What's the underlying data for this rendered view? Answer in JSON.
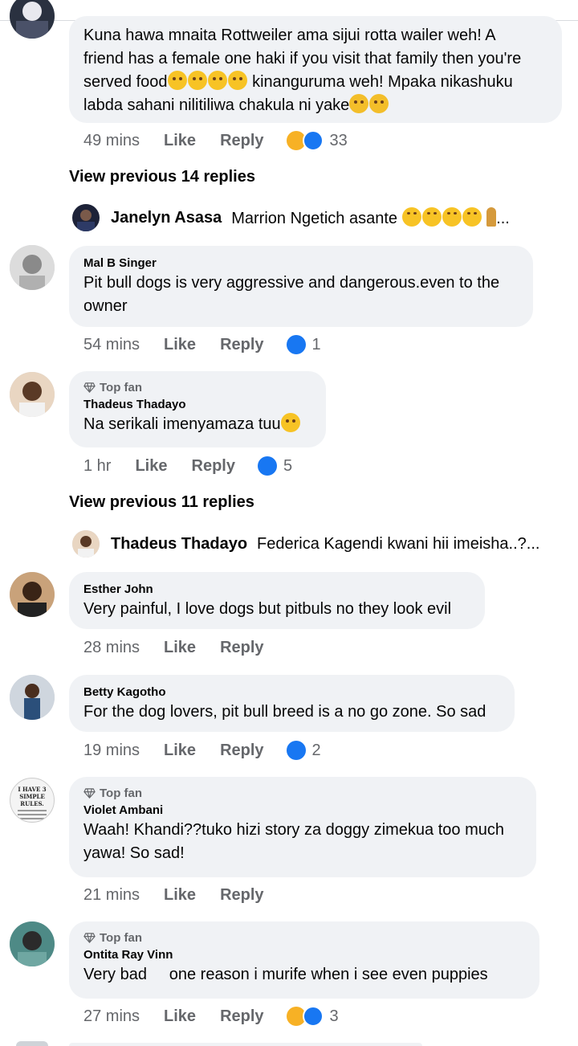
{
  "comments": [
    {
      "id": "kuna",
      "name": "",
      "text_lines": [
        "Kuna hawa mnaita Rottweiler ama sijui rotta wailer weh! A",
        "friend has a female one haki if you visit  that family then you're",
        "served food",
        "kinanguruma weh! Mpaka nikashuku",
        "labda sahani nilitiliwa chakula ni yake"
      ],
      "time": "49 mins",
      "like": "Like",
      "reply": "Reply",
      "reactions": [
        "haha",
        "like"
      ],
      "count": "33"
    },
    {
      "id": "mal",
      "name": "Mal B Singer",
      "text_lines": [
        "Pit bull dogs is very aggressive and dangerous.even to the",
        "owner"
      ],
      "time": "54 mins",
      "like": "Like",
      "reply": "Reply",
      "reactions": [
        "like"
      ],
      "count": "1"
    },
    {
      "id": "thadeus",
      "badge": "Top fan",
      "name": "Thadeus Thadayo",
      "text_lines": [
        "Na serikali imenyamaza tuu"
      ],
      "time": "1 hr",
      "like": "Like",
      "reply": "Reply",
      "reactions": [
        "like"
      ],
      "count": "5"
    },
    {
      "id": "esther",
      "name": "Esther John",
      "text_lines": [
        "Very painful, I love dogs but pitbuls no they look evil"
      ],
      "time": "28 mins",
      "like": "Like",
      "reply": "Reply"
    },
    {
      "id": "betty",
      "name": "Betty Kagotho",
      "text_lines": [
        "For the dog lovers, pit bull breed is a no go zone. So sad"
      ],
      "time": "19 mins",
      "like": "Like",
      "reply": "Reply",
      "reactions": [
        "like"
      ],
      "count": "2"
    },
    {
      "id": "violet",
      "badge": "Top fan",
      "name": "Violet Ambani",
      "text_lines": [
        "Waah! Khandi??tuko hizi story za doggy zimekua too much",
        "yawa! So sad!"
      ],
      "time": "21 mins",
      "like": "Like",
      "reply": "Reply",
      "avatar_text": [
        "I HAVE 3",
        "SIMPLE RULES."
      ]
    },
    {
      "id": "ontita",
      "badge": "Top fan",
      "name": "Ontita Ray Vinn",
      "text_lines": [
        "Very bad     one reason i murife when i see even puppies"
      ],
      "time": "27 mins",
      "like": "Like",
      "reply": "Reply",
      "reactions": [
        "haha",
        "like"
      ],
      "count": "3"
    }
  ],
  "view_previous": [
    "View previous 14 replies",
    "View previous 11 replies"
  ],
  "reply_previews": [
    {
      "name": "Janelyn Asasa",
      "text": "Marrion Ngetich asante",
      "suffix": "..."
    },
    {
      "name": "Thadeus Thadayo",
      "text": "Federica Kagendi kwani hii imeisha..?..."
    }
  ],
  "colors": {
    "bubble": "#f0f2f5",
    "secondary_text": "#65676b",
    "like_blue": "#1877f2",
    "haha_yellow": "#f7b125"
  }
}
